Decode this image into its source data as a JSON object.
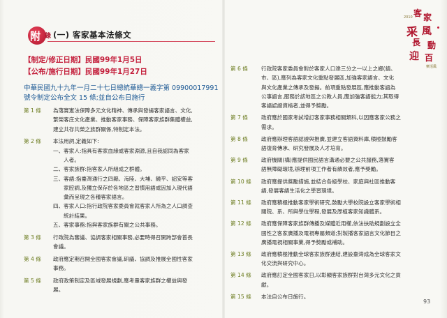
{
  "header": {
    "badge_char": "附",
    "badge_small": "錄",
    "title": "(一) 客家基本法條文"
  },
  "dates": {
    "revised": "【制定/修正日期】民國99年1月5日",
    "published": "【公布/施行日期】民國99年1月27日"
  },
  "law_ref": {
    "line1": "中華民國九十九年一月二十七日總統華總一義字第 09900017991",
    "line2": "號令制定公布全文 15 條;並自公布日施行"
  },
  "left_articles": [
    {
      "label": "第 1 條",
      "lines": [
        "為落實憲法保障多元文化精神、傳承與發揚客家語言、文化,",
        "繁榮客庄文化產業、推動客家事務、保障客家族群集體權益,",
        "建立共存共榮之族群關係,特制定本法。"
      ]
    },
    {
      "label": "第 2 條",
      "lines": [
        "本法用詞,定義如下:",
        "一、客家人:指具有客家血緣或客家淵源,且自我認同為客家",
        "　　人者。",
        "二、客家族群:指客家人所組成之群體。",
        "三、客語:指臺灣通行之四縣、海陸、大埔、饒平、詔安等客",
        "　　家腔調,及獨立保存於各地區之習慣用語或因加入現代語",
        "　　彙而呈現之各種客家語言。",
        "四、客家人口:指行政院客家委員會就客家人所為之人口調查",
        "　　統計結果。",
        "五、客家事務:指與客家族群有關之公共事務。"
      ]
    },
    {
      "label": "第 3 條",
      "lines": [
        "行政院為審議、協調客家相關事務,必要時得召開跨部會首長",
        "會議。"
      ]
    },
    {
      "label": "第 4 條",
      "lines": [
        "政府應定期召開全國客家會議,研議、協調及推展全國性客家",
        "事務。"
      ]
    },
    {
      "label": "第 5 條",
      "lines": [
        "政府政策制定及區域發展規劃,應考量客家族群之權益與發",
        "展。"
      ]
    }
  ],
  "right_articles": [
    {
      "label": "第 6 條",
      "lines": [
        "行政院客家委員會對於客家人口達三分之一以上之鄉(鎮、",
        "市、區),應列為客家文化重點發展區,加強客家語言、文化",
        "與文化產業之傳承及發揚。前項重點發展區,應推動客語為",
        "公事語言,服務於該地區之公教人員,應加強客語能力;其取得",
        "客語認證資格者,並得予獎勵。"
      ]
    },
    {
      "label": "第 7 條",
      "lines": [
        "政府應於國家考試增訂客家事務相關類科,以因應客家公務之",
        "需求。"
      ]
    },
    {
      "label": "第 8 條",
      "lines": [
        "政府應辦理客語認證與推廣,並建立客語資料庫,積極鼓勵客",
        "語復育傳承、研究發展及人才培育。"
      ]
    },
    {
      "label": "第 9 條",
      "lines": [
        "政府機關(構)應提供國民語言溝通必要之公共服務,落實客",
        "語無障礙環境,辦理前項工作者有績效者,應予獎勵。"
      ]
    },
    {
      "label": "第 10 條",
      "lines": [
        "政府應提供獎勵措施,並結合各級學校、家庭與社區推動客",
        "語,發展客語生活化之學習環境。"
      ]
    },
    {
      "label": "第 11 條",
      "lines": [
        "政府應積極推動客家學術研究,鼓勵大學校院設立客家學術相",
        "關院、系、所與學位學程,發展及厚植客家知識體系。"
      ]
    },
    {
      "label": "第 12 條",
      "lines": [
        "政府應保障客家族群傳播及媒體近用權,依法扶助規劃設立全",
        "國性之客家廣播及電視專屬頻道;對製播客家語言文化節目之",
        "廣播電視相關事業,得予獎勵或補助。"
      ]
    },
    {
      "label": "第 13 條",
      "lines": [
        "政府應積極推動全球客家族群連結,建設臺灣成為全球客家文",
        "化交流與研究中心。"
      ]
    },
    {
      "label": "第 14 條",
      "lines": [
        "政府應訂定全國客家日,以彰顯客家族群對台灣多元文化之貢",
        "獻。"
      ]
    },
    {
      "label": "第 15 條",
      "lines": [
        "本法自公布日施行。"
      ]
    }
  ],
  "logo": {
    "chars": [
      "客",
      "家",
      "采",
      "風",
      "長",
      "動",
      "迎",
      "百"
    ],
    "small_top": "2010",
    "small_bottom": "樂活風"
  },
  "page_number": "93",
  "colors": {
    "accent_red": "#c41f3c",
    "label_green": "#6b7b1f",
    "law_blue": "#1e5a95"
  }
}
